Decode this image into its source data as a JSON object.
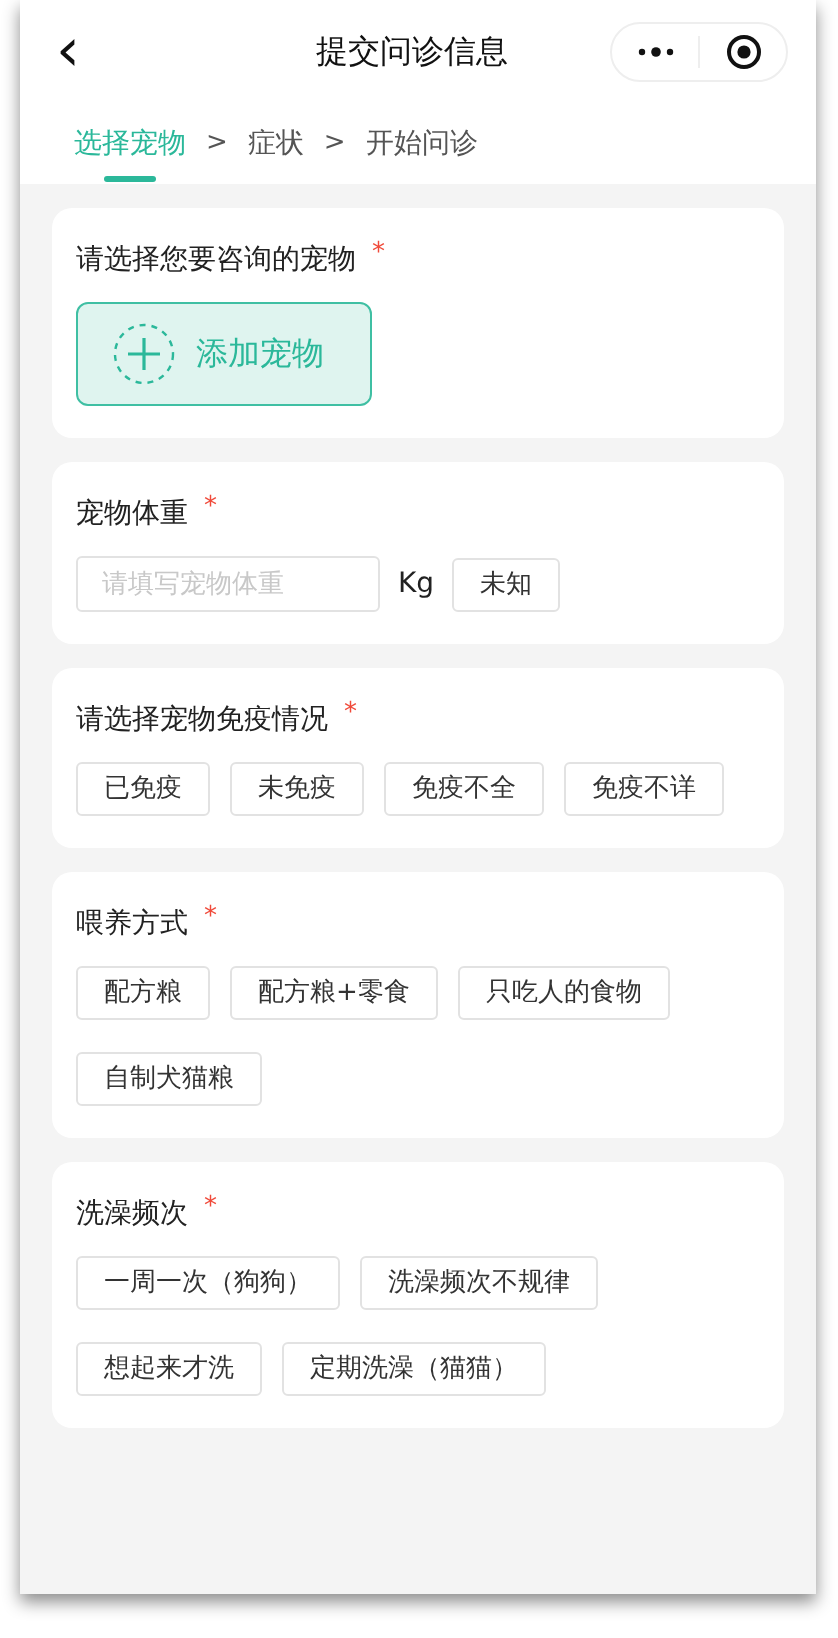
{
  "header": {
    "back": "‹",
    "title": "提交问诊信息"
  },
  "steps": [
    {
      "kind": "step",
      "text": "选择宠物",
      "selected": true
    },
    {
      "kind": "separator",
      "text": ">"
    },
    {
      "kind": "step",
      "text": "症状",
      "selected": false
    },
    {
      "kind": "separator",
      "text": ">"
    },
    {
      "kind": "step",
      "text": "开始问诊",
      "selected": false
    }
  ],
  "sections": [
    {
      "kind": "add",
      "title": "请选择您要咨询的宠物",
      "mark": "*",
      "button": "添加宠物"
    },
    {
      "kind": "weight",
      "title": "宠物体重",
      "mark": "*",
      "placeholder": "请填写宠物体重",
      "unit": "Kg",
      "options": [
        {
          "label": "未知",
          "selected": false
        }
      ]
    },
    {
      "kind": "options",
      "title": "请选择宠物免疫情况",
      "mark": "*",
      "options": [
        {
          "label": "已免疫",
          "selected": false
        },
        {
          "label": "未免疫",
          "selected": false
        },
        {
          "label": "免疫不全",
          "selected": false
        },
        {
          "label": "免疫不详",
          "selected": false
        }
      ]
    },
    {
      "kind": "options",
      "title": "喂养方式",
      "mark": "*",
      "options": [
        {
          "label": "配方粮",
          "selected": false
        },
        {
          "label": "配方粮+零食",
          "selected": false
        },
        {
          "label": "只吃人的食物",
          "selected": false
        },
        {
          "label": "自制犬猫粮",
          "selected": false
        }
      ]
    },
    {
      "kind": "options",
      "title": "洗澡频次",
      "mark": "*",
      "options": [
        {
          "label": "一周一次（狗狗）",
          "selected": false
        },
        {
          "label": "洗澡频次不规律",
          "selected": false
        },
        {
          "label": "想起来才洗",
          "selected": false
        },
        {
          "label": "定期洗澡（猫猫）",
          "selected": false
        }
      ]
    }
  ]
}
